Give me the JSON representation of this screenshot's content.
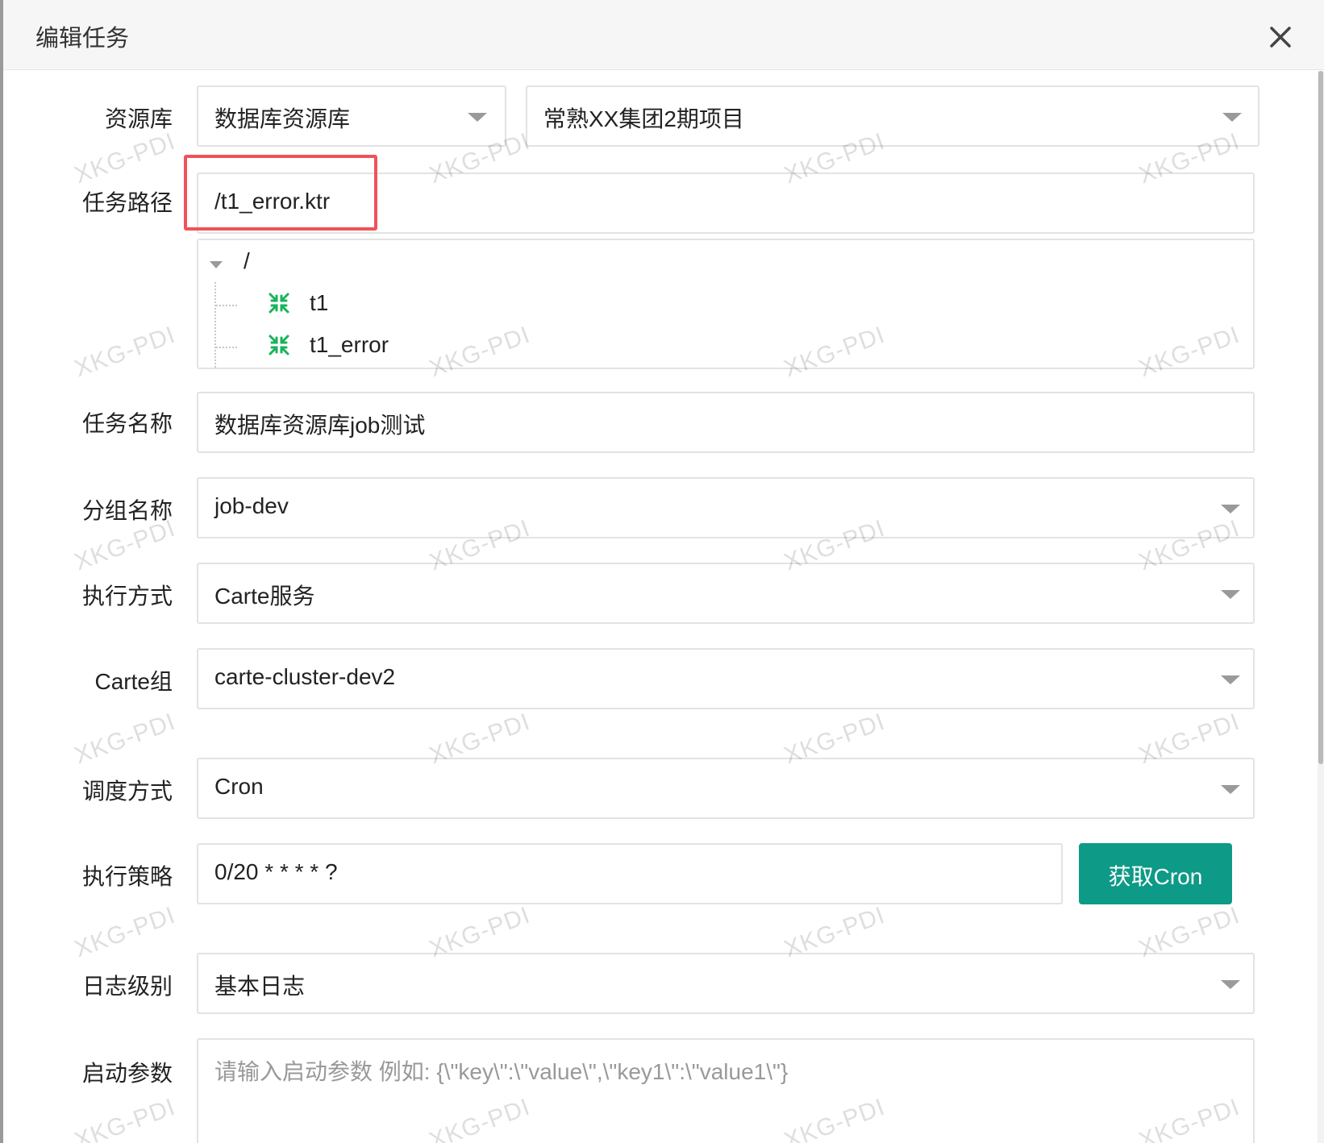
{
  "dialog": {
    "title": "编辑任务"
  },
  "form": {
    "resource": {
      "label": "资源库",
      "type_value": "数据库资源库",
      "project_value": "常熟XX集团2期项目"
    },
    "task_path": {
      "label": "任务路径",
      "value": "/t1_error.ktr",
      "tree": {
        "root": "/",
        "nodes": [
          {
            "label": "t1",
            "icon": "transformation-icon"
          },
          {
            "label": "t1_error",
            "icon": "transformation-icon"
          }
        ]
      }
    },
    "task_name": {
      "label": "任务名称",
      "value": "数据库资源库job测试"
    },
    "group_name": {
      "label": "分组名称",
      "value": "job-dev"
    },
    "exec_mode": {
      "label": "执行方式",
      "value": "Carte服务"
    },
    "carte_group": {
      "label": "Carte组",
      "value": "carte-cluster-dev2"
    },
    "schedule_mode": {
      "label": "调度方式",
      "value": "Cron"
    },
    "exec_strategy": {
      "label": "执行策略",
      "value": "0/20 * * * * ?",
      "button": "获取Cron"
    },
    "log_level": {
      "label": "日志级别",
      "value": "基本日志"
    },
    "start_params": {
      "label": "启动参数",
      "value": "",
      "placeholder": "请输入启动参数 例如: {\\\"key\\\":\\\"value\\\",\\\"key1\\\":\\\"value1\\\"}"
    }
  },
  "watermark": {
    "text": "XKG-PDI"
  },
  "colors": {
    "primary": "#0d9a86",
    "highlight": "#f0525a",
    "tree_icon": "#19b35a"
  }
}
